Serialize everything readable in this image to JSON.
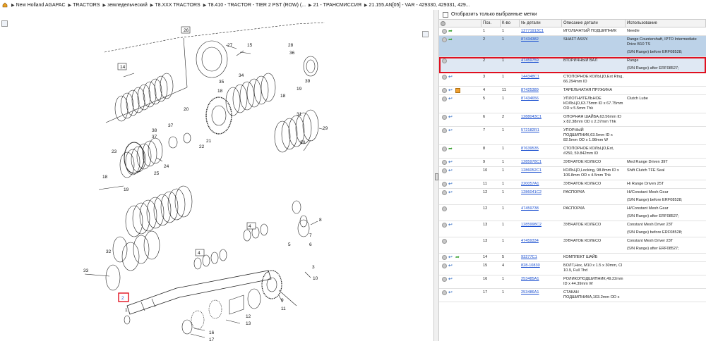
{
  "breadcrumb": {
    "home_icon": "home-icon",
    "items": [
      "New Holland AGAPAC",
      "TRACTORS",
      "земледельческий",
      "T8.XXX TRACTORS",
      "T8.410 - TRACTOR - TIER 2 PST (ROW) (...",
      "21 - ТРАНСМИССИЯ",
      "21.155.AN[05] - VAR - 429330, 429331, 429..."
    ]
  },
  "filter": {
    "label": "Отобразить только выбранные метки",
    "checked": false
  },
  "table": {
    "headers": [
      "Поз.",
      "К-во",
      "№ детали",
      "Описание детали",
      "Использование"
    ],
    "rows": [
      {
        "pos": "1",
        "qty": "1",
        "part": "12771913C1",
        "desc": "ИГОЛЬЧАТЫЙ ПОДШИПНИК",
        "use": "Needle",
        "icons": [
          "dot",
          "garr"
        ],
        "extra": []
      },
      {
        "pos": "2",
        "qty": "1",
        "part": "87434382",
        "desc": "SHAFT ASSY.",
        "use": "Range Countershaft, IPTO Intermediate Drive B10 TS",
        "icons": [
          "dot",
          "garr"
        ],
        "extra": [
          "(S/N Range) before ERF08528;"
        ],
        "selected": true
      },
      {
        "pos": "2",
        "qty": "1",
        "part": "47459759",
        "desc": "ВТОРИЧНЫЙ ВАЛ",
        "use": "Range",
        "icons": [
          "dot"
        ],
        "extra": [
          "(S/N Range) after ERF08527;"
        ],
        "highlighted": true
      },
      {
        "pos": "3",
        "qty": "1",
        "part": "144348C1",
        "desc": "СТОПОРНОЕ КОЛЬЦО,Ext Rtng, 66.294mm ID",
        "use": "",
        "icons": [
          "dot",
          "arr"
        ],
        "extra": []
      },
      {
        "pos": "4",
        "qty": "11",
        "part": "87425389",
        "desc": "ТАРЕЛЬЧАТАЯ ПРУЖИНА",
        "use": "",
        "icons": [
          "dot",
          "arr",
          "box"
        ],
        "extra": []
      },
      {
        "pos": "5",
        "qty": "1",
        "part": "87434656",
        "desc": "УПЛОТНИТЕЛЬНОЕ КОЛЬЦО,63.75mm ID x 67.75mm OD x 5.5mm Thk",
        "use": "Clutch Lube",
        "icons": [
          "dot",
          "arr"
        ],
        "extra": []
      },
      {
        "pos": "6",
        "qty": "2",
        "part": "1288043C1",
        "desc": "ОПОРНАЯ ШАЙБА,63.56mm ID x 82.38mm OD x 2.37mm Thk",
        "use": "",
        "icons": [
          "dot",
          "arr"
        ],
        "extra": []
      },
      {
        "pos": "7",
        "qty": "1",
        "part": "572182R1",
        "desc": "УПОРНЫЙ ПОДШИПНИК,63.5mm ID x 82.5mm OD x 1.98mm W",
        "use": "",
        "icons": [
          "dot",
          "arr"
        ],
        "extra": []
      },
      {
        "pos": "8",
        "qty": "1",
        "part": "87639535",
        "desc": "СТОПОРНОЕ КОЛЬЦО,Ext, #250, 59.842mm ID",
        "use": "",
        "icons": [
          "dot",
          "garr"
        ],
        "extra": []
      },
      {
        "pos": "9",
        "qty": "1",
        "part": "1285978C1",
        "desc": "ЗУБЧАТОЕ КОЛЕСО",
        "use": "Med Range Driven 39T",
        "icons": [
          "dot",
          "arr"
        ],
        "extra": []
      },
      {
        "pos": "10",
        "qty": "1",
        "part": "1286052C1",
        "desc": "КОЛЬЦО,Locking, 98.8mm ID x 106.8mm OD x 4.5mm Thk",
        "use": "Shift Clutch TFE Seal",
        "icons": [
          "dot",
          "arr"
        ],
        "extra": []
      },
      {
        "pos": "11",
        "qty": "1",
        "part": "220057A1",
        "desc": "ЗУБЧАТОЕ КОЛЕСО",
        "use": "Hi Range Driven 25T",
        "icons": [
          "dot",
          "arr"
        ],
        "extra": []
      },
      {
        "pos": "12",
        "qty": "1",
        "part": "1286041C2",
        "desc": "РАСПОРКА",
        "use": "Hi/Constant Mesh Gear",
        "icons": [
          "dot",
          "arr"
        ],
        "extra": [
          "(S/N Range) before ERF08528;"
        ]
      },
      {
        "pos": "12",
        "qty": "1",
        "part": "47459738",
        "desc": "РАСПОРКА",
        "use": "Hi/Constant Mesh Gear",
        "icons": [
          "dot"
        ],
        "extra": [
          "(S/N Range) after ERF08527;"
        ]
      },
      {
        "pos": "13",
        "qty": "1",
        "part": "1285998C2",
        "desc": "ЗУБЧАТОЕ КОЛЕСО",
        "use": "Constant Mesh Driver 23T",
        "icons": [
          "dot",
          "arr"
        ],
        "extra": [
          "(S/N Range) before ERF08528;"
        ]
      },
      {
        "pos": "13",
        "qty": "1",
        "part": "47459334",
        "desc": "ЗУБЧАТОЕ КОЛЕСО",
        "use": "Constant Mesh Driver 23T",
        "icons": [
          "dot"
        ],
        "extra": [
          "(S/N Range) after ERF08527;"
        ]
      },
      {
        "pos": "14",
        "qty": "5",
        "part": "93277C1",
        "desc": "КОМПЛЕКТ ШАЙБ",
        "use": "",
        "icons": [
          "dot",
          "arr",
          "garr"
        ],
        "extra": []
      },
      {
        "pos": "15",
        "qty": "4",
        "part": "828-10830",
        "desc": "БОЛТ,Hex, M10 x 1.5 x 30mm, Cl 10.9, Full Thd",
        "use": "",
        "icons": [
          "dot",
          "arr"
        ],
        "extra": []
      },
      {
        "pos": "16",
        "qty": "1",
        "part": "253485A1",
        "desc": "РОЛИКОПОДШИПНИК,49.22mm ID x 44.39mm W",
        "use": "",
        "icons": [
          "dot",
          "arr"
        ],
        "extra": []
      },
      {
        "pos": "17",
        "qty": "1",
        "part": "253486A1",
        "desc": "СТАКАН ПОДШИПНИКА,103.2mm OD x",
        "use": "",
        "icons": [
          "dot",
          "arr"
        ],
        "extra": []
      }
    ]
  },
  "diagram": {
    "callouts": [
      "1",
      "2",
      "3",
      "4",
      "5",
      "6",
      "7",
      "8",
      "9",
      "10",
      "11",
      "12",
      "13",
      "14",
      "15",
      "16",
      "17",
      "18",
      "19",
      "20",
      "21",
      "22",
      "23",
      "24",
      "25",
      "26",
      "27",
      "28",
      "29",
      "30",
      "31",
      "32",
      "33",
      "34",
      "35",
      "36",
      "37",
      "38",
      "39"
    ],
    "boxed": [
      "26",
      "14",
      "4",
      "4",
      "2"
    ],
    "highlight": "2"
  }
}
